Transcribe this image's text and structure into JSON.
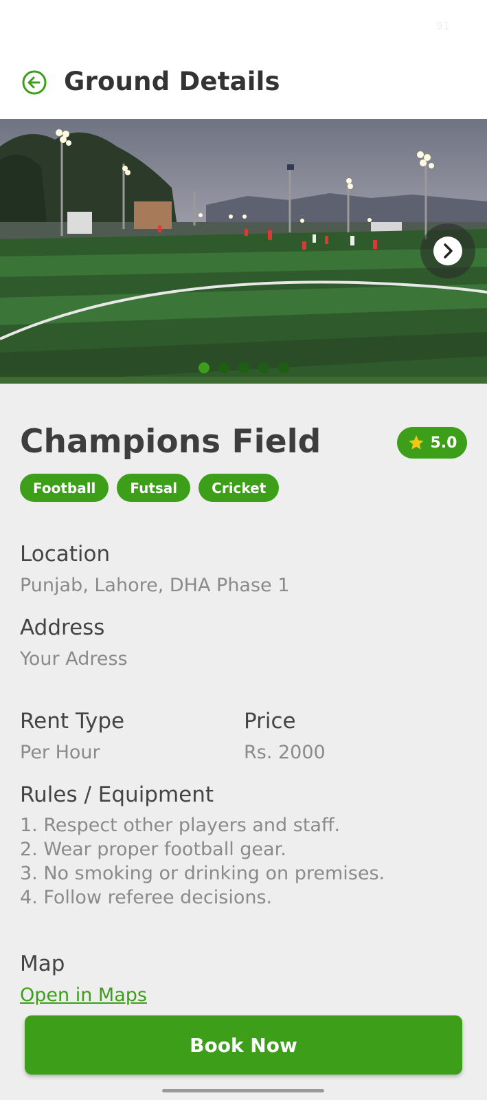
{
  "status_bar": {
    "text": "91"
  },
  "header": {
    "title": "Ground Details",
    "back_icon": "arrow-left-circle-icon"
  },
  "carousel": {
    "image_count": 5,
    "active_index": 0,
    "next_icon": "chevron-right-icon"
  },
  "ground": {
    "name": "Champions Field",
    "rating": "5.0",
    "rating_icon": "star-icon",
    "sports": [
      "Football",
      "Futsal",
      "Cricket"
    ]
  },
  "details": {
    "location_label": "Location",
    "location": "Punjab, Lahore, DHA Phase 1",
    "address_label": "Address",
    "address": "Your Adress",
    "rent_type_label": "Rent Type",
    "rent_type": "Per Hour",
    "price_label": "Price",
    "price": "Rs. 2000",
    "rules_label": "Rules / Equipment",
    "rules": [
      "1. Respect other players and staff.",
      "2. Wear proper football gear.",
      "3. No smoking or drinking on premises.",
      "4. Follow referee decisions."
    ],
    "map_label": "Map",
    "map_link": "Open in Maps"
  },
  "actions": {
    "book_label": "Book Now"
  },
  "colors": {
    "accent": "#3d9e1a",
    "background": "#eeeeee",
    "star": "#f5c518"
  }
}
